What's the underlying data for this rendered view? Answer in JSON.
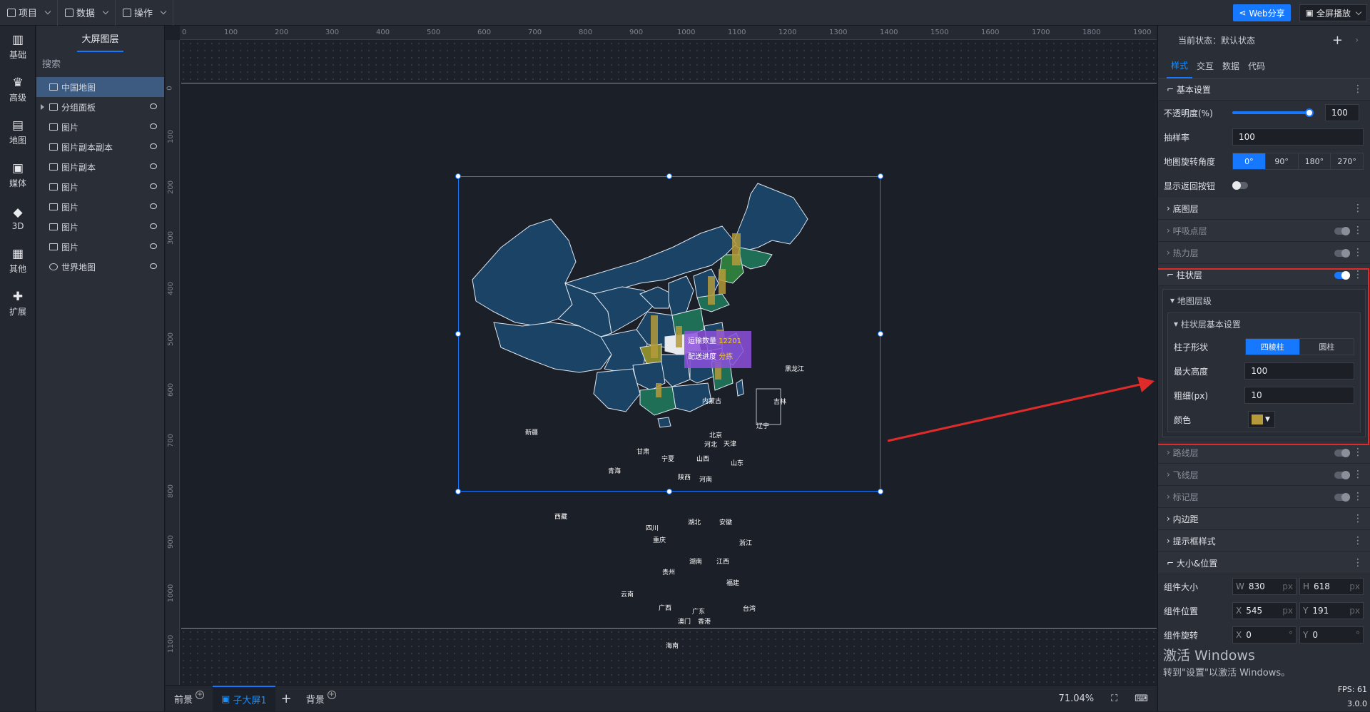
{
  "topbar": {
    "menus": [
      {
        "label": "项目",
        "icon": "file-icon"
      },
      {
        "label": "数据",
        "icon": "database-icon"
      },
      {
        "label": "操作",
        "icon": "grid-icon"
      }
    ],
    "web_share": "Web分享",
    "fullscreen": "全屏播放"
  },
  "rail": [
    {
      "label": "基础",
      "glyph": "▥"
    },
    {
      "label": "高级",
      "glyph": "♛"
    },
    {
      "label": "地图",
      "glyph": "▤"
    },
    {
      "label": "媒体",
      "glyph": "▣"
    },
    {
      "label": "3D",
      "glyph": "◆"
    },
    {
      "label": "其他",
      "glyph": "▦"
    },
    {
      "label": "扩展",
      "glyph": "✚"
    }
  ],
  "layers": {
    "title": "大屏图层",
    "search_placeholder": "搜索",
    "items": [
      {
        "label": "中国地图"
      },
      {
        "label": "分组面板"
      },
      {
        "label": "图片"
      },
      {
        "label": "图片副本副本"
      },
      {
        "label": "图片副本"
      },
      {
        "label": "图片"
      },
      {
        "label": "图片"
      },
      {
        "label": "图片"
      },
      {
        "label": "图片"
      },
      {
        "label": "世界地图"
      }
    ]
  },
  "ruler": {
    "top": [
      "0",
      "100",
      "200",
      "300",
      "400",
      "500",
      "600",
      "700",
      "800",
      "900",
      "1000",
      "1100",
      "1200",
      "1300",
      "1400",
      "1500",
      "1600",
      "1700",
      "1800",
      "1900"
    ],
    "left": [
      "0",
      "100",
      "200",
      "300",
      "400",
      "500",
      "600",
      "700",
      "800",
      "900",
      "1000",
      "1100"
    ]
  },
  "map": {
    "provinces": [
      "黑龙江",
      "内蒙古",
      "吉林",
      "辽宁",
      "新疆",
      "北京",
      "天津",
      "河北",
      "山西",
      "山东",
      "宁夏",
      "甘肃",
      "青海",
      "陕西",
      "河南",
      "西藏",
      "四川",
      "重庆",
      "湖北",
      "安徽",
      "浙江",
      "江西",
      "湖南",
      "贵州",
      "福建",
      "云南",
      "广西",
      "广东",
      "台湾",
      "澳门",
      "香港",
      "海南"
    ],
    "tooltip": {
      "line1_label": "运输数量",
      "line1_value": "12201",
      "line2_label": "配送进度",
      "line2_value": "分拣"
    }
  },
  "bottombar": {
    "tabs": [
      "前景",
      "子大屏1",
      "背景"
    ],
    "zoom": "71.04%"
  },
  "rpanel": {
    "state_label": "当前状态：默认状态",
    "tabs": [
      "样式",
      "交互",
      "数据",
      "代码"
    ],
    "basic": {
      "title": "基本设置",
      "opacity_label": "不透明度(%)",
      "opacity_value": "100",
      "sampling_label": "抽样率",
      "sampling_value": "100",
      "rotation_label": "地图旋转角度",
      "rotation_options": [
        "0°",
        "90°",
        "180°",
        "270°"
      ],
      "back_btn_label": "显示返回按钮"
    },
    "sections": {
      "base_layer": "底图层",
      "breath_layer": "呼吸点层",
      "heat_layer": "热力层",
      "bar_layer": "柱状层",
      "route_layer": "路线层",
      "fly_layer": "飞线层",
      "mark_layer": "标记层",
      "padding": "内边距",
      "tooltip_style": "提示框样式",
      "size_pos": "大小&位置"
    },
    "bar": {
      "map_level": "地图层级",
      "basic": "柱状层基本设置",
      "shape_label": "柱子形状",
      "shape_options": [
        "四棱柱",
        "圆柱"
      ],
      "max_height_label": "最大高度",
      "max_height_value": "100",
      "thickness_label": "粗细(px)",
      "thickness_value": "10",
      "color_label": "颜色",
      "color_value": "#b49a3a"
    },
    "size": {
      "size_label": "组件大小",
      "w": "830",
      "h": "618",
      "pos_label": "组件位置",
      "x": "545",
      "y": "191",
      "rot_label": "组件旋转",
      "rx": "0",
      "ry": "0",
      "unit_px": "px",
      "unit_deg": "°"
    },
    "fps": "FPS: 61",
    "version": "3.0.0"
  },
  "windows": {
    "line1": "激活 Windows",
    "line2": "转到\"设置\"以激活 Windows。"
  }
}
